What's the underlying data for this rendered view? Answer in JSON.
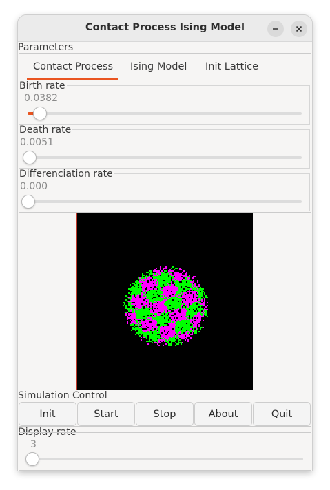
{
  "window": {
    "title": "Contact Process Ising Model",
    "minimize_icon": "minimize-icon",
    "close_icon": "close-icon"
  },
  "parameters": {
    "group_label": "Parameters",
    "tabs": [
      {
        "label": "Contact Process",
        "active": true
      },
      {
        "label": "Ising Model",
        "active": false
      },
      {
        "label": "Init Lattice",
        "active": false
      }
    ],
    "sliders": [
      {
        "label": "Birth rate",
        "value_text": "0.0382",
        "fraction": 0.04
      },
      {
        "label": "Death rate",
        "value_text": "0.0051",
        "fraction": 0.0
      },
      {
        "label": "Differenciation rate",
        "value_text": "0.000",
        "fraction": 0.0
      }
    ]
  },
  "simulation": {
    "group_label": "Simulation Control",
    "buttons": [
      "Init",
      "Start",
      "Stop",
      "About",
      "Quit"
    ]
  },
  "display": {
    "group_label": "Display rate",
    "value_text": "3",
    "fraction": 0.0
  },
  "colors": {
    "accent": "#e95420",
    "lattice_background": "#000000",
    "species_a": "#00ff00",
    "species_b": "#ff00ff"
  }
}
